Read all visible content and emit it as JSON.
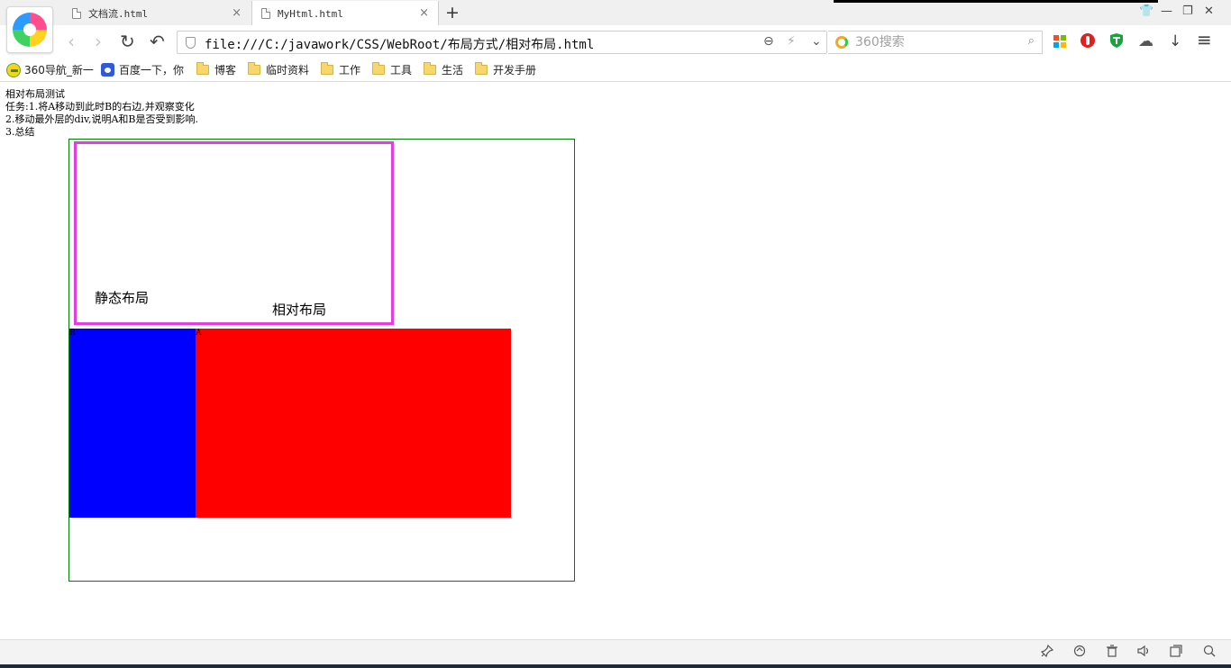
{
  "browser": {
    "tabs": [
      {
        "label": "文档流.html",
        "active": false
      },
      {
        "label": "MyHtml.html",
        "active": true
      }
    ],
    "new_tab": "+",
    "window_controls": {
      "skin": "👕",
      "minimize": "—",
      "restore": "❐",
      "close": "✕"
    },
    "tab_close_glyph": "×"
  },
  "navbar": {
    "back": "‹",
    "forward": "›",
    "reload": "↻",
    "undo": "↶",
    "url": "file:///C:/javawork/CSS/WebRoot/布局方式/相对布局.html",
    "zoom_glyph": "⊖",
    "speed_glyph": "⚡",
    "dropdown_glyph": "⌄",
    "search_placeholder": "360搜索",
    "search_glyph": "⌕",
    "menu_glyph": "≡",
    "download_glyph": "↓",
    "cloud_glyph": "☁"
  },
  "bookmarks": [
    {
      "label": "360导航_新一",
      "icon": "360-icon"
    },
    {
      "label": "百度一下，你",
      "icon": "baidu-icon"
    },
    {
      "label": "博客",
      "icon": "folder-icon"
    },
    {
      "label": "临时资料",
      "icon": "folder-icon"
    },
    {
      "label": "工作",
      "icon": "folder-icon"
    },
    {
      "label": "工具",
      "icon": "folder-icon"
    },
    {
      "label": "生活",
      "icon": "folder-icon"
    },
    {
      "label": "开发手册",
      "icon": "folder-icon"
    }
  ],
  "page": {
    "lines": [
      "相对布局测试",
      "任务:1.将A移动到此时B的右边,并观察变化",
      "2.移动最外层的div,说明A和B是否受到影响.",
      "3.总结"
    ],
    "static_label": "静态布局",
    "relative_label": "相对布局",
    "box_b_label": "B",
    "box_a_label": "A"
  },
  "colors": {
    "outer_border": "#008000",
    "pink_border": "#e43de1",
    "box_b": "#0000ff",
    "box_a": "#ff0000"
  },
  "statusbar": {
    "icons": [
      "pin-icon",
      "refresh-circle-icon",
      "trash-icon",
      "speaker-icon",
      "window-icon",
      "magnifier-icon"
    ]
  }
}
